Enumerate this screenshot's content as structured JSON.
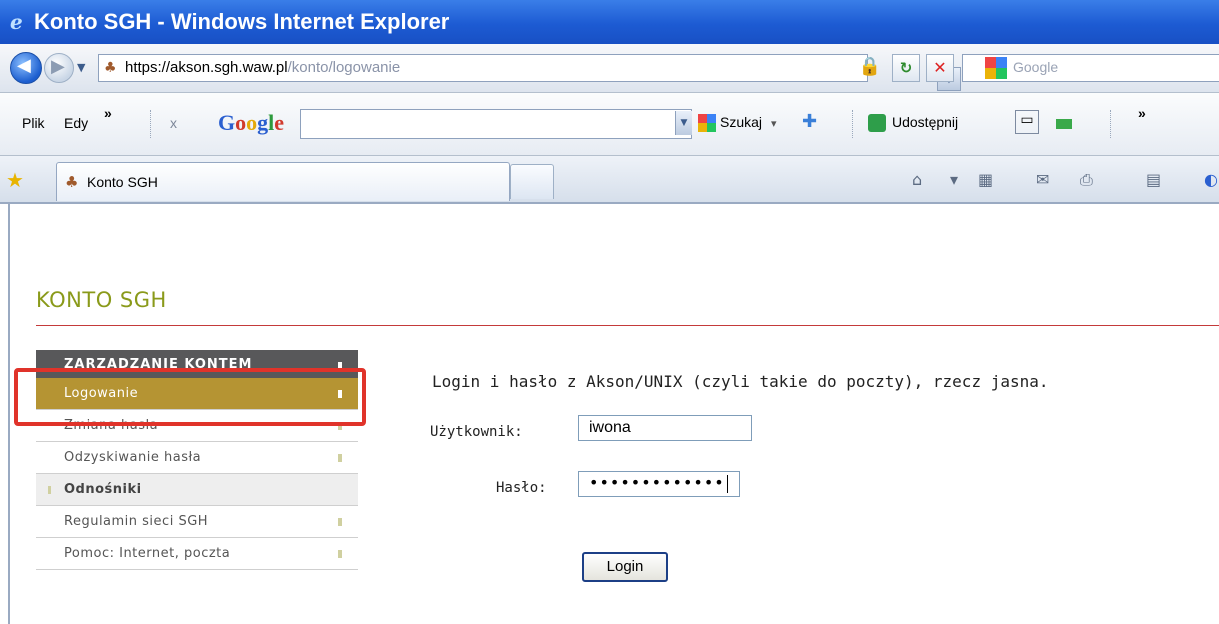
{
  "window": {
    "title": "Konto SGH - Windows Internet Explorer"
  },
  "address_bar": {
    "url_host": "https://akson.sgh.waw.pl",
    "url_path": "/konto/logowanie",
    "search_placeholder": "Google"
  },
  "toolbar": {
    "menu_file": "Plik",
    "menu_edit": "Edy",
    "overflow": "»",
    "close": "x",
    "search_button": "Szukaj",
    "share_button": "Udostępnij",
    "overflow_right": "»"
  },
  "tabs": [
    {
      "label": "Konto SGH"
    }
  ],
  "page": {
    "site_title": "KONTO SGH",
    "menu": {
      "header": "ZARZĄDZANIE KONTEM",
      "items": [
        {
          "label": "Logowanie",
          "active": true
        },
        {
          "label": "Zmiana hasła"
        },
        {
          "label": "Odzyskiwanie hasła"
        }
      ],
      "links_header": "Odnośniki",
      "links": [
        {
          "label": "Regulamin sieci SGH"
        },
        {
          "label": "Pomoc: Internet, poczta"
        }
      ]
    },
    "login_form": {
      "intro": "Login i hasło z Akson/UNIX (czyli takie do poczty), rzecz jasna.",
      "user_label": "Użytkownik:",
      "user_value": "iwona",
      "password_label": "Hasło:",
      "password_value": "•••••••••••••",
      "submit_label": "Login"
    }
  },
  "colors": {
    "accent_olive": "#8a9a1a",
    "menu_active": "#b59433",
    "highlight_red": "#e0332a"
  }
}
